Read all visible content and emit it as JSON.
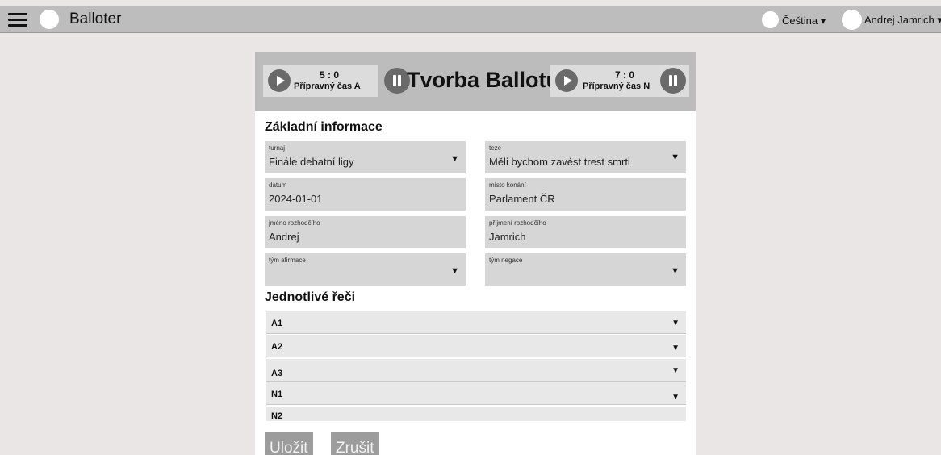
{
  "topbar": {
    "app_title": "Balloter",
    "language": "Čeština ▾",
    "user": "Andrej Jamrich ▾"
  },
  "header": {
    "title": "Tvorba Ballotu",
    "timer_a": {
      "score": "5 : 0",
      "label": "Přípravný čas A"
    },
    "timer_n": {
      "score": "7 : 0",
      "label": "Přípravný čas N"
    }
  },
  "basic_info": {
    "title": "Základní informace",
    "fields": {
      "turnaj": {
        "label": "turnaj",
        "value": "Finále debatní ligy"
      },
      "teze": {
        "label": "teze",
        "value": "Měli bychom zavést trest smrti"
      },
      "datum": {
        "label": "datum",
        "value": "2024-01-01"
      },
      "misto": {
        "label": "místo konání",
        "value": "Parlament ČR"
      },
      "jmeno": {
        "label": "jméno rozhodčího",
        "value": "Andrej"
      },
      "prijmeni": {
        "label": "příjmení rozhodčího",
        "value": "Jamrich"
      },
      "afirmace": {
        "label": "tým afirmace",
        "value": ""
      },
      "negace": {
        "label": "tým negace",
        "value": ""
      }
    }
  },
  "speeches": {
    "title": "Jednotlivé řeči",
    "items": [
      "A1",
      "A2",
      "A3",
      "N1",
      "N2"
    ]
  },
  "actions": {
    "save": "Uložit",
    "cancel": "Zrušit"
  },
  "icons": {
    "caret": "▼"
  },
  "colors": {
    "topbar": "#bdbdbd",
    "header": "#bcbcbc",
    "field": "#d6d6d6",
    "button": "#9c9c9c",
    "control": "#6a6a6a"
  }
}
